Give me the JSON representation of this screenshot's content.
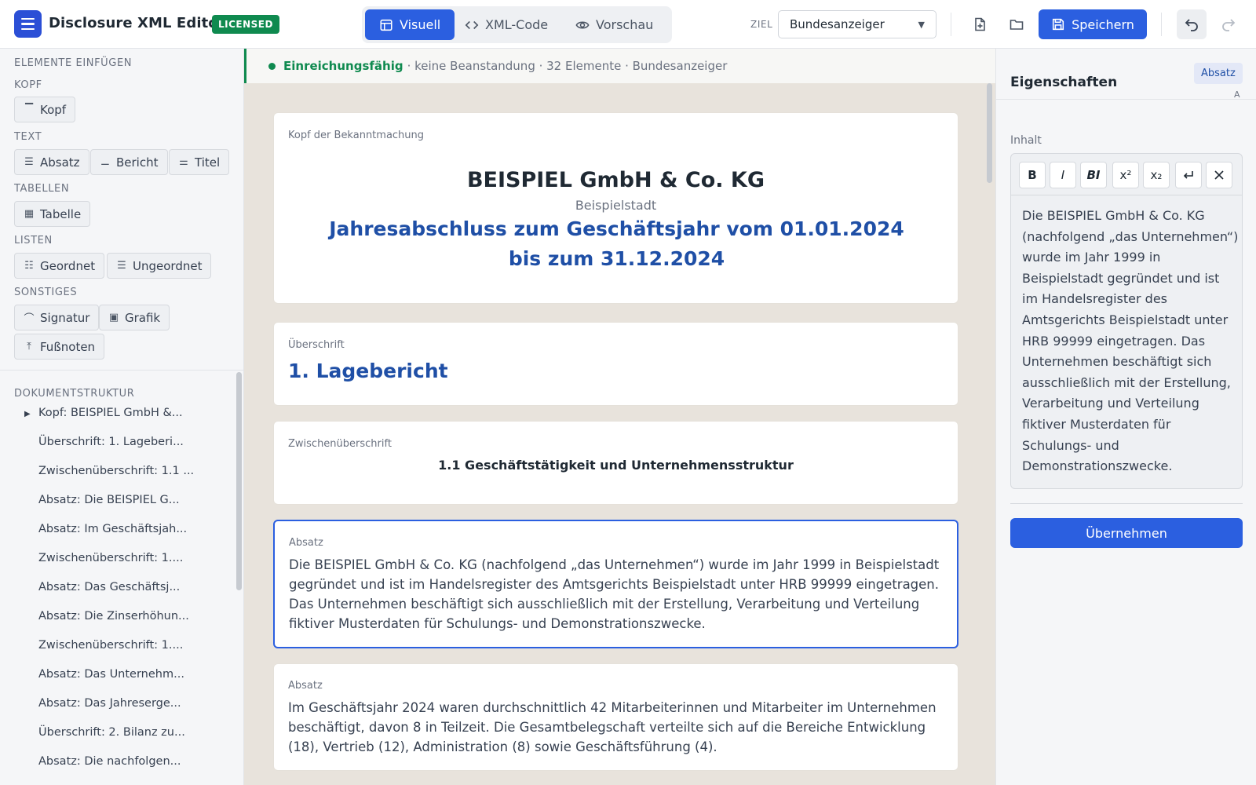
{
  "app": {
    "title": "Disclosure XML Editor",
    "license_badge": "LICENSED"
  },
  "modes": [
    {
      "label": "Visuell",
      "icon": "layout-icon",
      "active": true
    },
    {
      "label": "XML-Code",
      "icon": "code-icon",
      "active": false
    },
    {
      "label": "Vorschau",
      "icon": "eye-icon",
      "active": false
    }
  ],
  "target": {
    "label": "ZIEL",
    "selected": "Bundesanzeiger"
  },
  "toolbar": {
    "save_label": "Speichern"
  },
  "insert_panel": {
    "title": "ELEMENTE EINFÜGEN",
    "groups": [
      {
        "title": "KOPF",
        "items": [
          {
            "label": "Kopf",
            "icon": "header-icon"
          }
        ]
      },
      {
        "title": "TEXT",
        "items": [
          {
            "label": "Absatz",
            "icon": "paragraph-icon"
          },
          {
            "label": "Bericht",
            "icon": "report-icon"
          },
          {
            "label": "Titel",
            "icon": "title-icon"
          }
        ]
      },
      {
        "title": "TABELLEN",
        "items": [
          {
            "label": "Tabelle",
            "icon": "table-icon"
          }
        ]
      },
      {
        "title": "LISTEN",
        "items": [
          {
            "label": "Geordnet",
            "icon": "ordered-list-icon"
          },
          {
            "label": "Ungeordnet",
            "icon": "unordered-list-icon"
          }
        ]
      },
      {
        "title": "SONSTIGES",
        "items": [
          {
            "label": "Signatur",
            "icon": "signature-icon"
          },
          {
            "label": "Grafik",
            "icon": "image-icon"
          },
          {
            "label": "Fußnoten",
            "icon": "footnote-icon"
          }
        ]
      }
    ]
  },
  "structure": {
    "title": "DOKUMENTSTRUKTUR",
    "items": [
      "Kopf: BEISPIEL GmbH &...",
      "Überschrift: 1. Lageberi...",
      "Zwischenüberschrift: 1.1 ...",
      "Absatz: Die BEISPIEL G...",
      "Absatz: Im Geschäftsjah...",
      "Zwischenüberschrift: 1....",
      "Absatz: Das Geschäftsj...",
      "Absatz: Die Zinserhöhun...",
      "Zwischenüberschrift: 1....",
      "Absatz: Das Unternehm...",
      "Absatz: Das Jahreserge...",
      "Überschrift: 2. Bilanz zu...",
      "Absatz: Die nachfolgen..."
    ]
  },
  "status": {
    "ok": "Einreichungsfähig",
    "details": "· keine Beanstandung · 32 Elemente · Bundesanzeiger"
  },
  "document": {
    "kopf": {
      "label": "Kopf der Bekanntmachung",
      "company": "BEISPIEL GmbH & Co. KG",
      "city": "Beispielstadt",
      "title": "Jahresabschluss zum Geschäftsjahr vom 01.01.2024 bis zum 31.12.2024"
    },
    "heading": {
      "label": "Überschrift",
      "text": "1. Lagebericht"
    },
    "subheading": {
      "label": "Zwischenüberschrift",
      "text": "1.1 Geschäftstätigkeit und Unternehmensstruktur"
    },
    "para1": {
      "label": "Absatz",
      "text": "Die BEISPIEL GmbH & Co. KG (nachfolgend „das Unternehmen“) wurde im Jahr 1999 in Beispielstadt gegründet und ist im Handelsregister des Amtsgerichts Beispielstadt unter HRB 99999 eingetragen. Das Unternehmen beschäftigt sich ausschließlich mit der Erstellung, Verarbeitung und Verteilung fiktiver Musterdaten für Schulungs- und Demonstrationszwecke."
    },
    "para2": {
      "label": "Absatz",
      "text": "Im Geschäftsjahr 2024 waren durchschnittlich 42 Mitarbeiterinnen und Mitarbeiter im Unternehmen beschäftigt, davon 8 in Teilzeit. Die Gesamtbelegschaft verteilte sich auf die Bereiche Entwicklung (18), Vertrieb (12), Administration (8) sowie Geschäftsführung (4)."
    }
  },
  "properties": {
    "title": "Eigenschaften",
    "type_badge": "Absatz",
    "type_hint": "A",
    "content_label": "Inhalt",
    "format_buttons": [
      "B",
      "I",
      "BI",
      "x²",
      "x₂"
    ],
    "content": "Die BEISPIEL GmbH & Co. KG (nachfolgend „das Unternehmen“) wurde im Jahr 1999 in Beispielstadt gegründet und ist im Handelsregister des Amtsgerichts Beispielstadt unter HRB 99999 eingetragen. Das Unternehmen beschäftigt sich ausschließlich mit der Erstellung, Verarbeitung und Verteilung fiktiver Musterdaten für Schulungs- und Demonstrationszwecke.",
    "apply_label": "Übernehmen"
  }
}
